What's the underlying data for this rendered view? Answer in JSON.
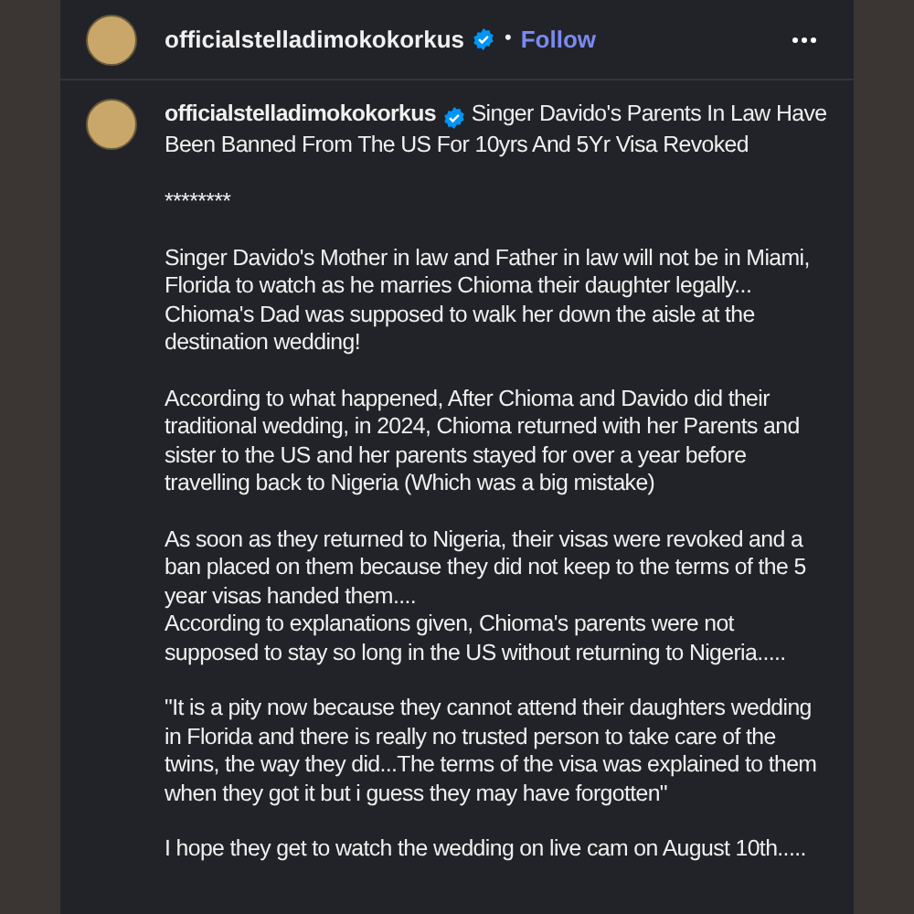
{
  "header": {
    "username": "officialstelladimokokorkus",
    "verified": true,
    "separator": "•",
    "follow": "Follow"
  },
  "caption": {
    "username": "officialstelladimokokorkus",
    "verified": true,
    "title": "Singer Davido's Parents In Law Have Been Banned From The US For 10yrs And 5Yr Visa Revoked",
    "paragraphs": [
      "********",
      "Singer Davido's Mother in law and Father in law will not be in Miami, Florida to watch as he marries Chioma their daughter legally... Chioma's Dad was supposed to walk her down the aisle at the destination wedding!",
      "According to what happened, After Chioma and Davido did their traditional wedding, in 2024, Chioma returned with her Parents and sister to the US and her parents stayed for over a year before travelling back to Nigeria (Which was a big mistake)",
      "As soon as they returned to Nigeria, their visas were revoked and a ban placed on them because they did not keep to the terms of the 5 year visas handed them....\nAccording to explanations given, Chioma's parents were not supposed to stay so long in the US without returning to Nigeria.....",
      "\"It is a pity now because they cannot attend their daughters wedding in Florida and there is really no trusted person to take care of the twins, the way they did...The terms of the visa was explained to them when they got it but i guess they may have forgotten\"",
      "I hope they get to watch the wedding on live cam on August 10th....."
    ]
  }
}
